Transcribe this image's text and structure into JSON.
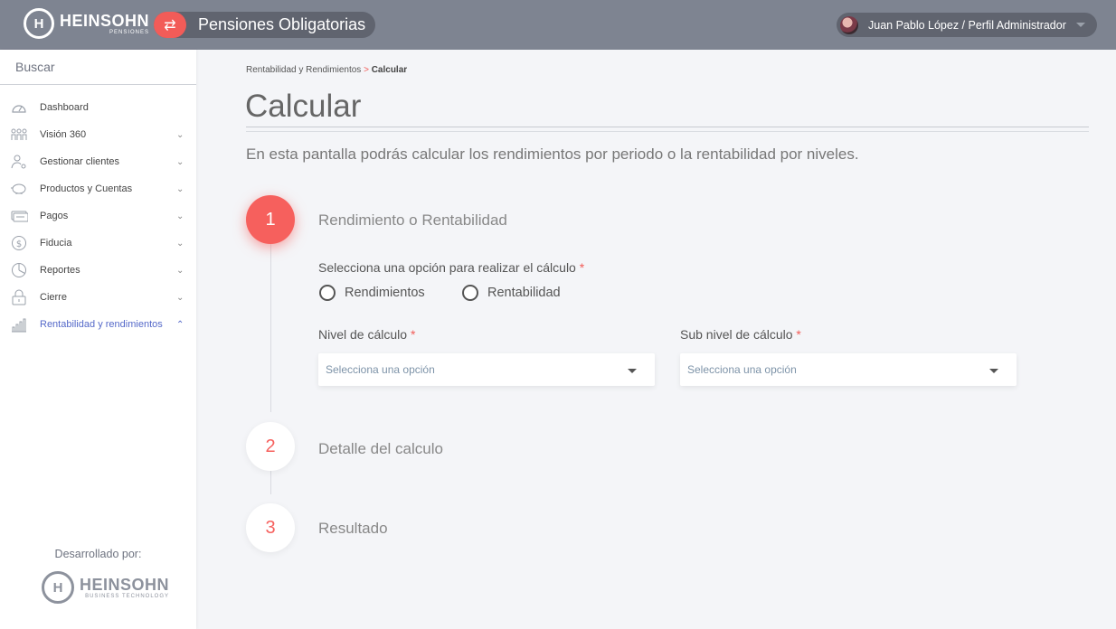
{
  "header": {
    "brand": "HEINSOHN",
    "brand_sub": "PENSIONES",
    "brand_mark": "H",
    "app_title": "Pensiones Obligatorias",
    "app_icon": "swap-icon",
    "user": "Juan Pablo López / Perfil Administrador"
  },
  "sidebar": {
    "search_placeholder": "Buscar",
    "items": [
      {
        "label": "Dashboard",
        "icon": "speedometer-icon",
        "chevron": ""
      },
      {
        "label": "Visión 360",
        "icon": "people-icon",
        "chevron": "⌄"
      },
      {
        "label": "Gestionar clientes",
        "icon": "user-gear-icon",
        "chevron": "⌄"
      },
      {
        "label": "Productos y Cuentas",
        "icon": "piggy-bank-icon",
        "chevron": "⌄"
      },
      {
        "label": "Pagos",
        "icon": "cash-icon",
        "chevron": "⌄"
      },
      {
        "label": "Fiducia",
        "icon": "dollar-coin-icon",
        "chevron": "⌄"
      },
      {
        "label": "Reportes",
        "icon": "pie-chart-icon",
        "chevron": "⌄"
      },
      {
        "label": "Cierre",
        "icon": "lock-icon",
        "chevron": "⌄"
      },
      {
        "label": "Rentabilidad y rendimientos",
        "icon": "bar-chart-icon",
        "chevron": "⌃"
      }
    ],
    "credit": "Desarrollado por:",
    "footer_brand": "HEINSOHN",
    "footer_brand_sub": "BUSINESS TECHNOLOGY",
    "accent": "#5569c9"
  },
  "breadcrumb": {
    "parent": "Rentabilidad y Rendimientos",
    "separator": ">",
    "current": "Calcular"
  },
  "page": {
    "title": "Calcular",
    "description": "En esta pantalla podrás calcular los rendimientos por periodo o la rentabilidad por niveles."
  },
  "steps": [
    {
      "number": "1",
      "title": "Rendimiento o Rentabilidad"
    },
    {
      "number": "2",
      "title": "Detalle del calculo"
    },
    {
      "number": "3",
      "title": "Resultado"
    }
  ],
  "form": {
    "question": "Selecciona una opción para realizar el cálculo",
    "required_mark": "*",
    "options": [
      "Rendimientos",
      "Rentabilidad"
    ],
    "nivel_label": "Nivel de cálculo",
    "subnivel_label": "Sub nivel de cálculo",
    "select_placeholder": "Selecciona una opción"
  },
  "colors": {
    "topbar": "#7e8491",
    "accent_red": "#f6605d",
    "background": "#f4f5f8"
  }
}
